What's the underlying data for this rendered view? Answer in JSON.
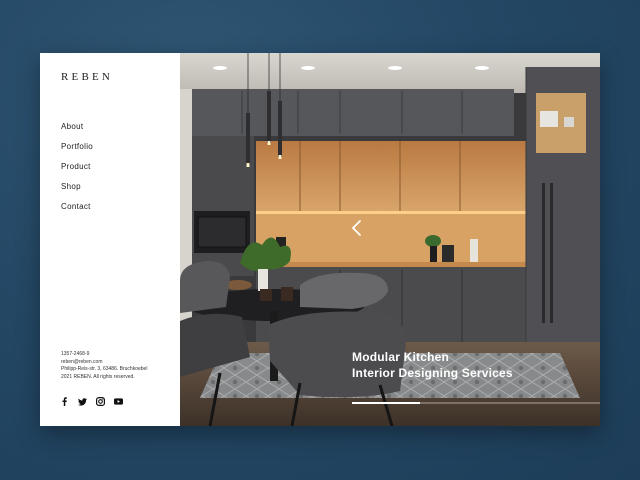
{
  "brand": {
    "logo": "REBEN"
  },
  "nav": {
    "items": [
      {
        "label": "About"
      },
      {
        "label": "Portfolio"
      },
      {
        "label": "Product"
      },
      {
        "label": "Shop"
      },
      {
        "label": "Contact"
      }
    ]
  },
  "contact": {
    "phone": "1357-2468-9",
    "email": "reben@reben.com",
    "address": "Philipp-Reis-str. 3, 63486. Bruchkoebel",
    "copyright": "2021 REBEN. All rights reserved."
  },
  "social": {
    "icons": [
      "facebook-icon",
      "twitter-icon",
      "instagram-icon",
      "youtube-icon"
    ]
  },
  "hero": {
    "headline_line1": "Modular Kitchen",
    "headline_line2": "Interior Designing Services",
    "slide_progress": 0.19,
    "prev_icon": "chevron-left-icon",
    "next_icon": "chevron-right-icon"
  },
  "colors": {
    "background": "#244865",
    "sidebar": "#ffffff",
    "text": "#222222",
    "headline": "#ffffff",
    "wood": "#c9925a",
    "cabinet": "#4a4a4c"
  }
}
